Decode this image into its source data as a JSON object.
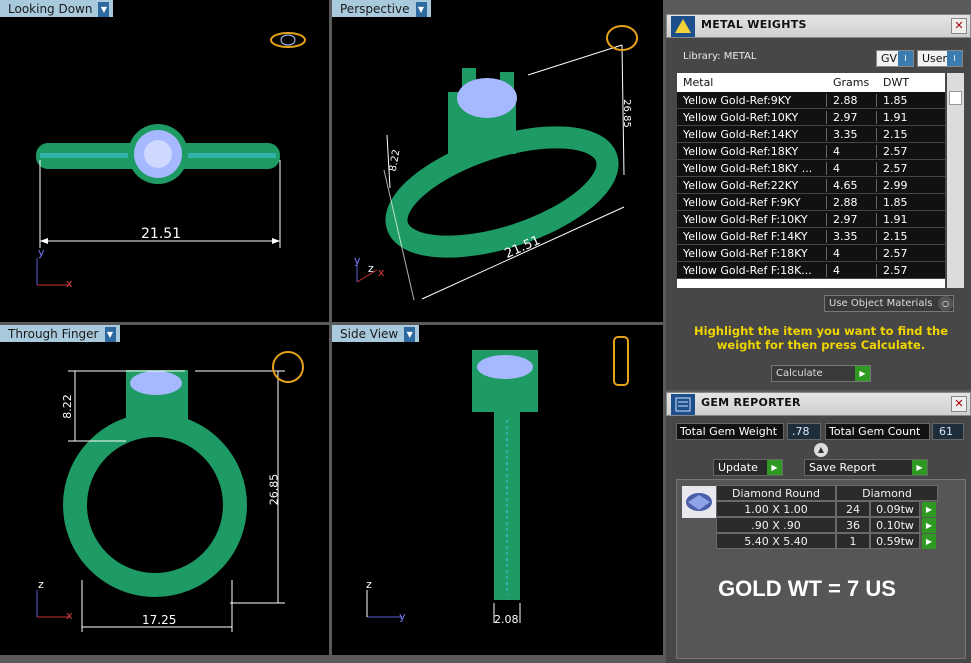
{
  "viewports": {
    "top_left": {
      "label": "Looking Down",
      "dim": "21.51",
      "axis_a": "y",
      "axis_b": "x"
    },
    "top_right": {
      "label": "Perspective",
      "dim_width": "21.51",
      "dim_height": "26.85",
      "dim_head": "8.22",
      "axis_a": "y",
      "axis_b": "z",
      "axis_c": "x"
    },
    "bottom_left": {
      "label": "Through Finger",
      "dim_width": "17.25",
      "dim_height": "26.85",
      "dim_head": "8.22",
      "axis_a": "z",
      "axis_b": "x"
    },
    "bottom_right": {
      "label": "Side View",
      "dim_width": "2.08",
      "axis_a": "z",
      "axis_b": "y"
    }
  },
  "metal_weights": {
    "title": "METAL WEIGHTS",
    "library_label": "Library: METAL",
    "gv_label": "GV",
    "user_label": "User",
    "columns": [
      "Metal",
      "Grams",
      "DWT"
    ],
    "rows": [
      [
        "Yellow Gold-Ref:9KY",
        "2.88",
        "1.85"
      ],
      [
        "Yellow Gold-Ref:10KY",
        "2.97",
        "1.91"
      ],
      [
        "Yellow Gold-Ref:14KY",
        "3.35",
        "2.15"
      ],
      [
        "Yellow Gold-Ref:18KY",
        "4",
        "2.57"
      ],
      [
        "Yellow Gold-Ref:18KY ...",
        "4",
        "2.57"
      ],
      [
        "Yellow Gold-Ref:22KY",
        "4.65",
        "2.99"
      ],
      [
        "Yellow Gold-Ref F:9KY",
        "2.88",
        "1.85"
      ],
      [
        "Yellow Gold-Ref F:10KY",
        "2.97",
        "1.91"
      ],
      [
        "Yellow Gold-Ref F:14KY",
        "3.35",
        "2.15"
      ],
      [
        "Yellow Gold-Ref F:18KY",
        "4",
        "2.57"
      ],
      [
        "Yellow Gold-Ref F:18K...",
        "4",
        "2.57"
      ]
    ],
    "use_object_materials": "Use Object Materials",
    "instruction": "Highlight the item you want to find the weight for then press Calculate.",
    "calculate_label": "Calculate"
  },
  "gem_reporter": {
    "title": "GEM REPORTER",
    "total_weight_label": "Total Gem Weight",
    "total_weight_value": ".78",
    "total_count_label": "Total Gem Count",
    "total_count_value": "61",
    "update_label": "Update",
    "save_report_label": "Save Report",
    "header_shape": "Diamond Round",
    "header_type": "Diamond",
    "rows": [
      [
        "1.00 X 1.00",
        "24",
        "0.09tw"
      ],
      [
        ".90 X .90",
        "36",
        "0.10tw"
      ],
      [
        "5.40 X 5.40",
        "1",
        "0.59tw"
      ]
    ],
    "note": "GOLD WT = 7 US"
  },
  "colors": {
    "ring": "#1e9a64",
    "stone": "#a6b8ff",
    "dim": "#ffffff",
    "highlight": "#f0d400"
  }
}
